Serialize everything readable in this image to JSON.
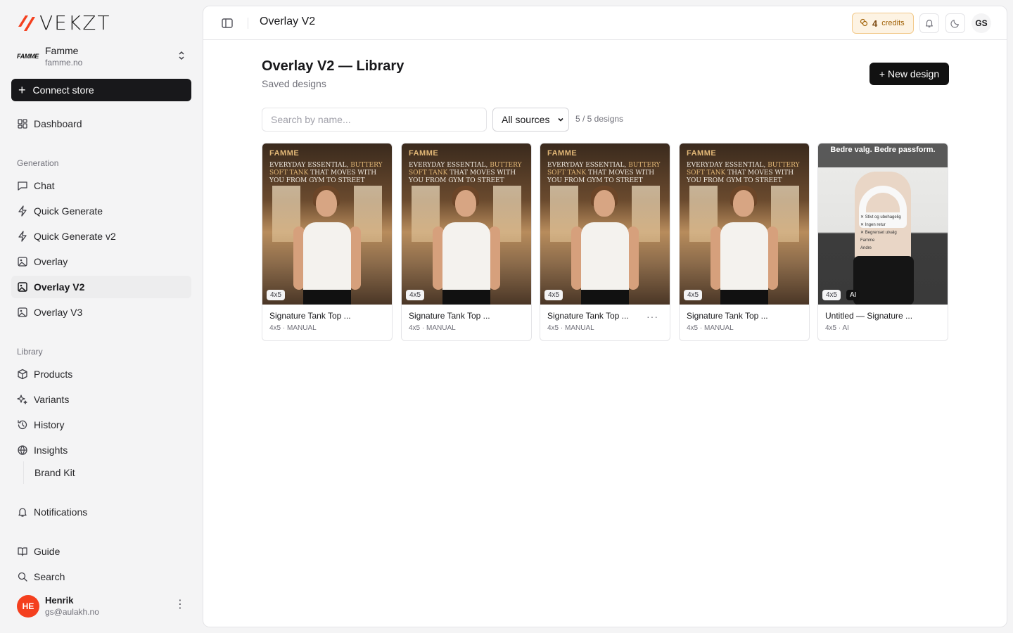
{
  "brand": {
    "logo_text": "VEKZT"
  },
  "store": {
    "logo_text": "FAMME",
    "name": "Famme",
    "domain": "famme.no"
  },
  "sidebar": {
    "connect_label": "Connect store",
    "dashboard": "Dashboard",
    "section_generation": "Generation",
    "generation_items": [
      "Chat",
      "Quick Generate",
      "Quick Generate v2",
      "Overlay",
      "Overlay V2",
      "Overlay V3"
    ],
    "section_library": "Library",
    "library_items": [
      "Products",
      "Variants",
      "History",
      "Insights"
    ],
    "brand_kit": "Brand Kit",
    "notifications": "Notifications",
    "guide": "Guide",
    "search": "Search"
  },
  "user": {
    "initials": "HE",
    "name": "Henrik",
    "email": "gs@aulakh.no"
  },
  "topbar": {
    "title": "Overlay V2",
    "credits_count": "4",
    "credits_label": "credits",
    "account_initials": "GS"
  },
  "library": {
    "title": "Overlay V2 — Library",
    "subtitle": "Saved designs",
    "new_design_label": "+ New design",
    "search_placeholder": "Search by name...",
    "source_filter": "All sources",
    "count_text": "5 / 5 designs"
  },
  "cards": [
    {
      "title": "Signature Tank Top ...",
      "meta": "4x5 · MANUAL",
      "ratio": "4x5",
      "brand": "FAMME",
      "headline_a": "Everyday essential, ",
      "headline_hl": "buttery soft tank",
      "headline_b": " that moves with you from gym to street"
    },
    {
      "title": "Signature Tank Top ...",
      "meta": "4x5 · MANUAL",
      "ratio": "4x5",
      "brand": "FAMME",
      "headline_a": "Everyday essential, ",
      "headline_hl": "buttery soft tank",
      "headline_b": " that moves with you from gym to street"
    },
    {
      "title": "Signature Tank Top ...",
      "meta": "4x5 · MANUAL",
      "ratio": "4x5",
      "brand": "FAMME",
      "headline_a": "Everyday essential, ",
      "headline_hl": "buttery soft tank",
      "headline_b": " that moves with you from gym to street",
      "more": "···"
    },
    {
      "title": "Signature Tank Top ...",
      "meta": "4x5 · MANUAL",
      "ratio": "4x5",
      "brand": "FAMME",
      "headline_a": "Everyday essential, ",
      "headline_hl": "buttery soft tank",
      "headline_b": " that moves with you from gym to street"
    },
    {
      "title": "Untitled — Signature ...",
      "meta": "4x5 · AI",
      "ratio": "4x5",
      "ai_badge": "AI",
      "overlay_title": "Bedre valg. Bedre passform.",
      "overlay_items": [
        "✕ Stivt og ubehagelig",
        "✕ Ingen retur",
        "✕ Begrenset utvalg",
        "Famme",
        "Andre"
      ]
    }
  ]
}
